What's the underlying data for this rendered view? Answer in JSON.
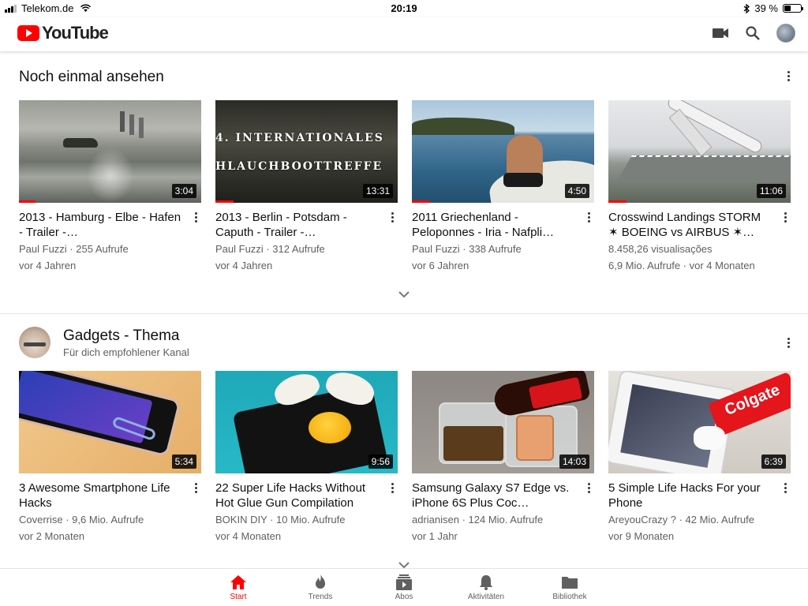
{
  "status": {
    "carrier": "Telekom.de",
    "time": "20:19",
    "battery": "39 %",
    "battery_level": 0.39
  },
  "header": {
    "logo_text": "YouTube",
    "icons": [
      "video-camera-icon",
      "search-icon",
      "account-avatar"
    ]
  },
  "colors": {
    "brand": "#ff0000",
    "text": "#0f0f0f",
    "meta": "#606060"
  },
  "section1": {
    "title": "Noch einmal ansehen",
    "videos": [
      {
        "title": "2013 - Hamburg - Elbe - Hafen - Trailer -…",
        "channel": "Paul Fuzzi · 255 Aufrufe",
        "age": "vor 4 Jahren",
        "duration": "3:04",
        "watched": 0.09
      },
      {
        "title": "2013 - Berlin - Potsdam - Caputh - Trailer -…",
        "channel": "Paul Fuzzi · 312 Aufrufe",
        "age": "vor 4 Jahren",
        "duration": "13:31",
        "watched": 0.1,
        "thumb_line1": "4. INTERNATIONALES",
        "thumb_line2": "HLAUCHBOOTTREFFE"
      },
      {
        "title": "2011 Griechenland - Peloponnes - Iria - Nafpli…",
        "channel": "Paul Fuzzi · 338 Aufrufe",
        "age": "vor 6 Jahren",
        "duration": "4:50",
        "watched": 0.1
      },
      {
        "title": "Crosswind Landings STORM ✶ BOEING vs AIRBUS ✶…",
        "channel": "8.458,26 visualisações",
        "age": "6,9 Mio. Aufrufe · vor 4 Monaten",
        "duration": "11:06",
        "watched": 0.1
      }
    ]
  },
  "section2": {
    "title": "Gadgets - Thema",
    "subtitle": "Für dich empfohlener Kanal",
    "videos": [
      {
        "title": "3 Awesome Smartphone Life Hacks",
        "channel": "Coverrise · 9,6 Mio. Aufrufe",
        "age": "vor 2 Monaten",
        "duration": "5:34"
      },
      {
        "title": "22 Super Life Hacks Without Hot Glue Gun Compilation",
        "channel": "BOKIN DIY · 10 Mio. Aufrufe",
        "age": "vor 4 Monaten",
        "duration": "9:56"
      },
      {
        "title": "Samsung Galaxy S7 Edge vs. iPhone 6S Plus Coc…",
        "channel": "adrianisen · 124 Mio. Aufrufe",
        "age": "vor 1 Jahr",
        "duration": "14:03"
      },
      {
        "title": "5 Simple Life Hacks For your Phone",
        "channel": "AreyouCrazy ? · 42 Mio. Aufrufe",
        "age": "vor 9 Monaten",
        "duration": "6:39",
        "thumb_text": "Colgate"
      }
    ]
  },
  "bottom_nav": {
    "items": [
      {
        "label": "Start",
        "icon": "home-icon",
        "active": true
      },
      {
        "label": "Trends",
        "icon": "flame-icon"
      },
      {
        "label": "Abos",
        "icon": "subscriptions-icon"
      },
      {
        "label": "Aktivitäten",
        "icon": "bell-icon"
      },
      {
        "label": "Bibliothek",
        "icon": "folder-icon"
      }
    ]
  }
}
